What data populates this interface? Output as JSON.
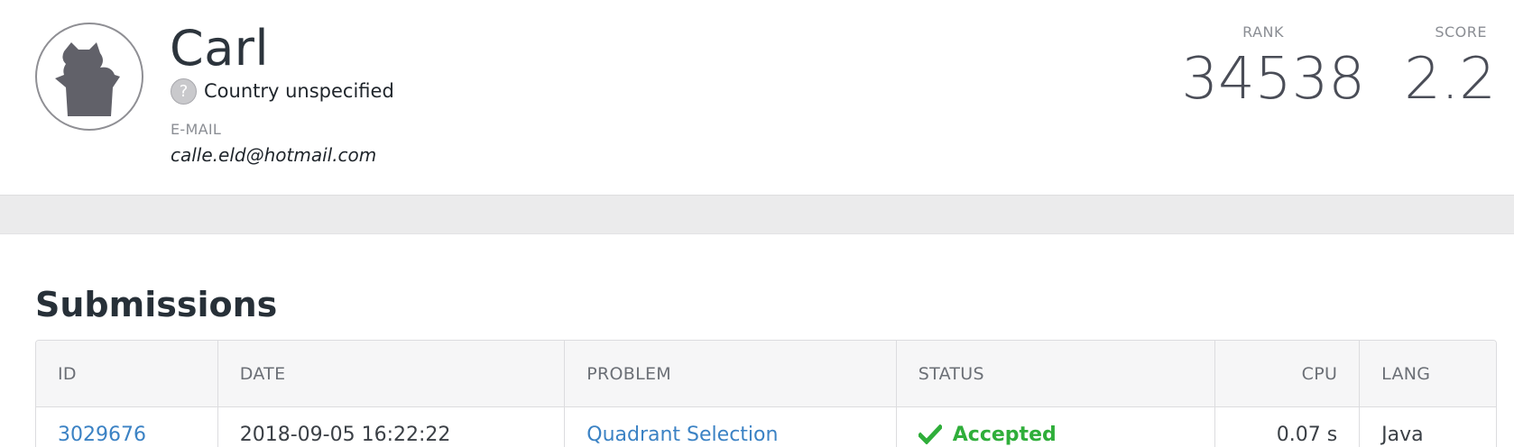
{
  "profile": {
    "name": "Carl",
    "country": "Country unspecified",
    "country_icon": "question-icon",
    "country_icon_glyph": "?",
    "email_label": "E-MAIL",
    "email": "calle.eld@hotmail.com"
  },
  "stats": {
    "rank_label": "RANK",
    "rank_value": "34538",
    "score_label": "SCORE",
    "score_value": "2.2"
  },
  "submissions": {
    "title": "Submissions",
    "columns": {
      "id": "ID",
      "date": "DATE",
      "problem": "PROBLEM",
      "status": "STATUS",
      "cpu": "CPU",
      "lang": "LANG"
    },
    "rows": [
      {
        "id": "3029676",
        "date": "2018-09-05 16:22:22",
        "problem": "Quadrant Selection",
        "status": "Accepted",
        "cpu": "0.07 s",
        "lang": "Java"
      }
    ]
  },
  "colors": {
    "link": "#3b82c4",
    "accepted": "#2fae3a",
    "band": "#ebebec"
  }
}
